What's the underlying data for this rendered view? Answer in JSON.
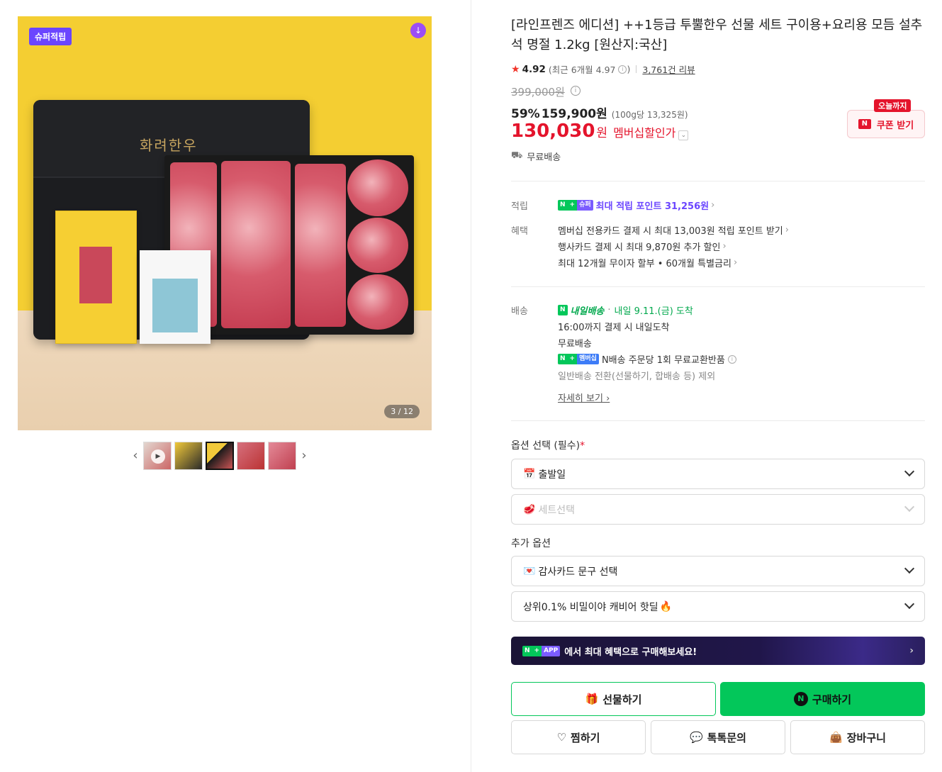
{
  "gallery": {
    "badge": "슈퍼적립",
    "download_icon": "download-icon",
    "counter": "3 / 12",
    "thumb_count": 5,
    "selected_thumb": 3,
    "bag_logo": "화려한우"
  },
  "product": {
    "title": "[라인프렌즈 에디션] ++1등급 투뿔한우 선물 세트 구이용+요리용 모듬 설추석 명절 1.2kg [원산지:국산]",
    "rating": "4.92",
    "rating_recent": "(최근 6개월 4.97",
    "rating_recent_close": ")",
    "reviews": "3,761건 리뷰",
    "original_price": "399,000원",
    "discount": "59%",
    "price": "159,900원",
    "unit_price": "(100g당 13,325원)",
    "member_price": "130,030",
    "member_price_won": "원",
    "member_label": "멤버십할인가",
    "coupon_tag": "오늘까지",
    "coupon_label": "쿠폰 받기",
    "shipping": "무료배송"
  },
  "benefits": {
    "points_label": "적립",
    "points_text": "최대 적립 포인트 31,256원",
    "benefit_label": "혜택",
    "lines": [
      "멤버십 전용카드 결제 시 최대 13,003원 적립 포인트 받기",
      "행사카드 결제 시 최대 9,870원 추가 할인",
      "최대 12개월 무이자 할부 • 60개월 특별금리"
    ]
  },
  "delivery": {
    "label": "배송",
    "tomorrow_tag": "내일배송",
    "arrival": "내일 9.11.(금) 도착",
    "cutoff": "16:00까지 결제 시 내일도착",
    "free": "무료배송",
    "exchange": "N배송 주문당 1회 무료교환반품",
    "excluded": "일반배송 전환(선물하기, 합배송 등) 제외",
    "more": "자세히 보기"
  },
  "options": {
    "title": "옵션 선택 (필수)",
    "required_mark": "*",
    "date_select": "출발일",
    "set_select": "세트선택",
    "extra_title": "추가 옵션",
    "card_select": "감사카드 문구 선택",
    "caviar_select": "상위0.1% 비밀이야 캐비어 핫딜"
  },
  "app_banner": {
    "text": "에서 최대 혜택으로 구매해보세요!",
    "pill": "APP"
  },
  "actions": {
    "gift": "선물하기",
    "buy": "구매하기",
    "wish": "찜하기",
    "talk": "톡톡문의",
    "cart": "장바구니"
  },
  "colors": {
    "naver_green": "#03c75a",
    "sale_red": "#e4142c",
    "super_purple": "#6b46ff"
  }
}
